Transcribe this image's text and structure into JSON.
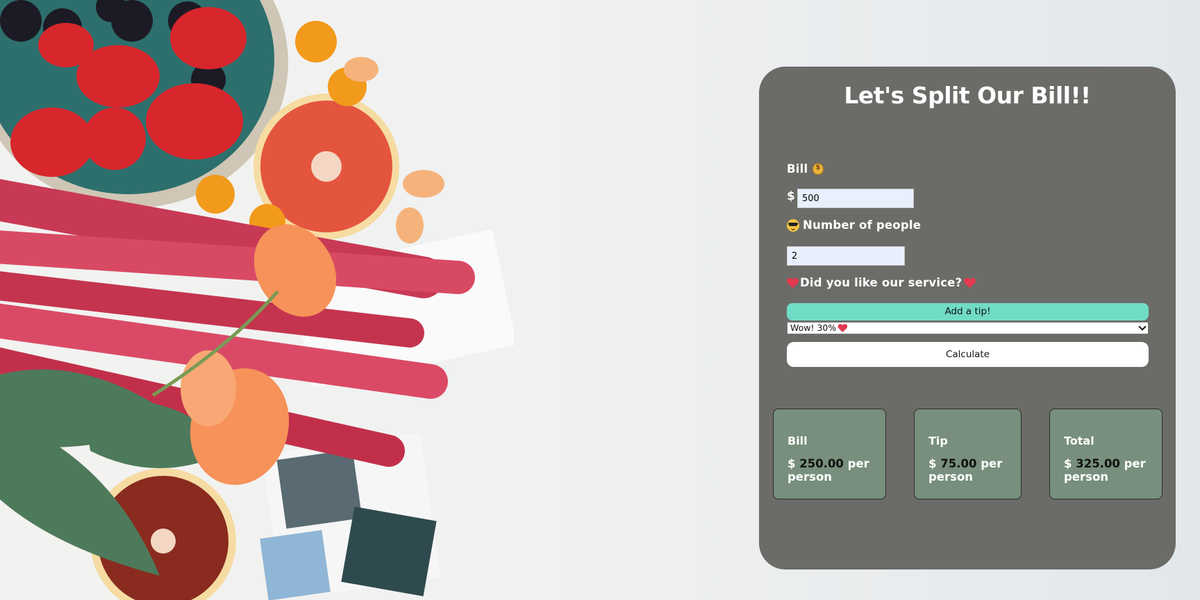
{
  "card": {
    "title": "Let's Split Our Bill!!",
    "bill_label": "Bill",
    "currency_symbol": "$",
    "bill_value": "500",
    "people_label": "Number of people",
    "people_value": "2",
    "service_question": "Did you like our service?",
    "tip_button_label": "Add a tip!",
    "tip_selected": "Wow! 30%",
    "calculate_label": "Calculate"
  },
  "results": {
    "bill": {
      "title": "Bill",
      "currency": "$",
      "amount": "250.00",
      "suffix": "per person"
    },
    "tip": {
      "title": "Tip",
      "currency": "$",
      "amount": "75.00",
      "suffix": "per person"
    },
    "total": {
      "title": "Total",
      "currency": "$",
      "amount": "325.00",
      "suffix": "per person"
    }
  },
  "icons": [
    "money-bag-icon",
    "sunglasses-face-icon",
    "heart-icon",
    "chevron-down-icon"
  ],
  "colors": {
    "card_background": "#6b6c68",
    "tip_button": "#71dcc6",
    "result_background": "#778f7c",
    "input_background": "#e8f0fe"
  }
}
